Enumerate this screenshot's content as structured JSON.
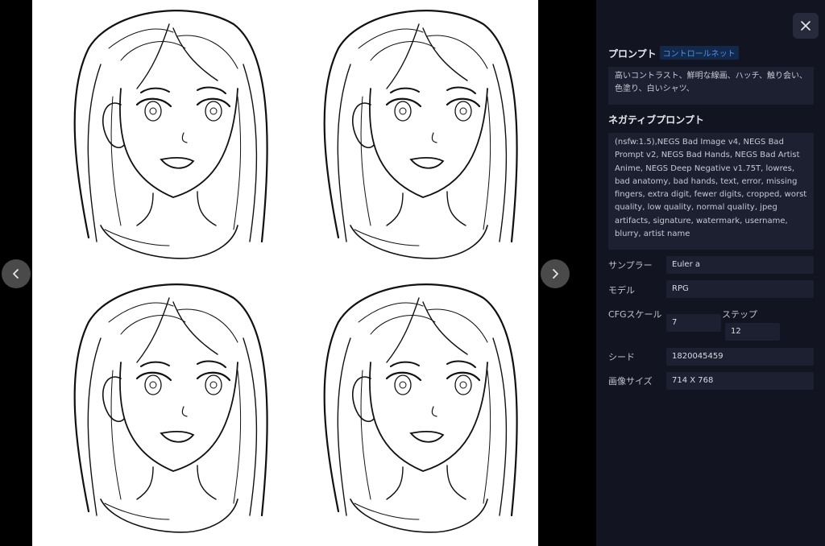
{
  "viewer": {
    "prev_icon": "chevron-left-icon",
    "next_icon": "chevron-right-icon"
  },
  "panel": {
    "close_icon": "close-icon",
    "prompt_title": "プロンプト",
    "prompt_tag": "コントロールネット",
    "prompt_text": "高いコントラスト、鮮明な線画、ハッチ、触り会い、色塗り、白いシャツ、",
    "negative_title": "ネガティブプロンプト",
    "negative_text": "(nsfw:1.5),NEGS Bad Image v4, NEGS Bad Prompt v2, NEGS Bad Hands, NEGS Bad Artist Anime, NEGS Deep Negative v1.75T, lowres, bad anatomy, bad hands, text, error, missing fingers, extra digit, fewer digits, cropped, worst quality, low quality, normal quality, jpeg artifacts, signature, watermark, username, blurry, artist name",
    "sampler_label": "サンプラー",
    "sampler_value": "Euler a",
    "model_label": "モデル",
    "model_value": "RPG",
    "cfg_label": "CFGスケール",
    "cfg_value": "7",
    "steps_label": "ステップ",
    "steps_value": "12",
    "seed_label": "シード",
    "seed_value": "1820045459",
    "size_label": "画像サイズ",
    "size_value": "714 X 768"
  },
  "colors": {
    "panel_bg": "#121421",
    "field_bg": "#1d2030",
    "tag_bg": "#13294b",
    "tag_text": "#4f8fe6"
  }
}
